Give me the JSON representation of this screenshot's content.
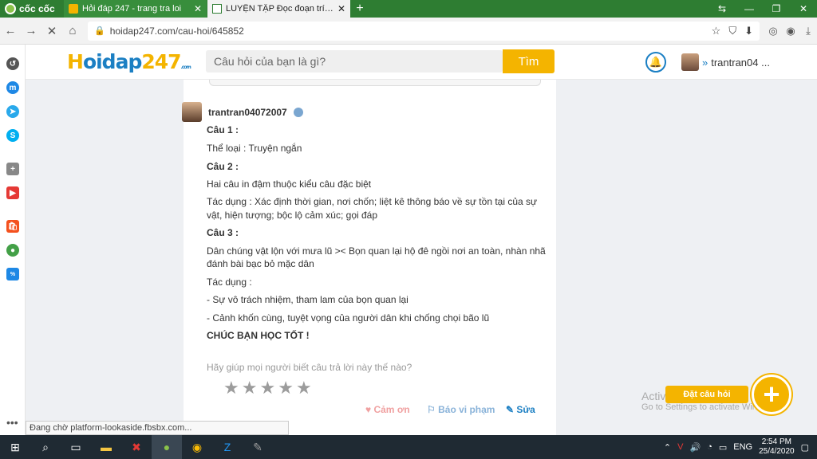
{
  "browser": {
    "brand": "cốc cốc",
    "tabs": [
      {
        "title": "Hỏi đáp 247 - trang tra loi",
        "active": false
      },
      {
        "title": "LUYỆN TẬP Đọc đoạn trích sa",
        "active": true
      }
    ],
    "new_tab": "+",
    "url": "hoidap247.com/cau-hoi/645852",
    "status_text": "Đang chờ platform-lookaside.fbsbx.com..."
  },
  "site": {
    "logo": {
      "h": "H",
      "rest": "oidap",
      "num": "247",
      "com": ".com"
    },
    "search_placeholder": "Câu hỏi của bạn là gì?",
    "search_button": "Tìm",
    "username": "trantran04 ..."
  },
  "answer": {
    "author": "trantran04072007",
    "lines": [
      {
        "text": "Câu 1 :",
        "bold": true
      },
      {
        "text": "Thể loại : Truyện ngắn",
        "bold": false
      },
      {
        "text": "Câu 2 :",
        "bold": true
      },
      {
        "text": "Hai câu in đậm thuộc kiểu câu đặc biệt",
        "bold": false
      },
      {
        "text": "Tác dụng :  Xác định thời gian, nơi chốn; liệt kê thông báo về sự tồn tại của sự",
        "bold": false
      },
      {
        "text": "vật, hiện tượng; bộc lộ cảm xúc; gọi đáp",
        "bold": false
      },
      {
        "text": "Câu 3 :",
        "bold": true
      },
      {
        "text": "Dân chúng vật lộn với mưa lũ >< Bọn quan lại hộ đê ngồi nơi an toàn, nhàn nhã",
        "bold": false
      },
      {
        "text": "đánh bài bạc bỏ mặc dân",
        "bold": false
      },
      {
        "text": "Tác dụng :",
        "bold": false
      },
      {
        "text": "- Sự vô trách nhiệm, tham lam của bọn quan lại",
        "bold": false
      },
      {
        "text": "- Cảnh khốn cùng, tuyệt vọng của người dân khi chống chọi bão lũ",
        "bold": false
      },
      {
        "text": "CHÚC BẠN HỌC TỐT !",
        "bold": true
      }
    ],
    "help_text": "Hãy giúp mọi người biết câu trả lời này thế nào?",
    "rating": 0,
    "actions": {
      "thanks": "Cảm ơn",
      "report": "Báo vi phạm",
      "edit": "Sửa"
    }
  },
  "windows_watermark": {
    "title": "Activate Windows",
    "sub": "Go to Settings to activate Windows."
  },
  "ask_button_label": "Đặt câu hỏi",
  "taskbar": {
    "language": "ENG",
    "time": "2:54 PM",
    "date": "25/4/2020"
  }
}
